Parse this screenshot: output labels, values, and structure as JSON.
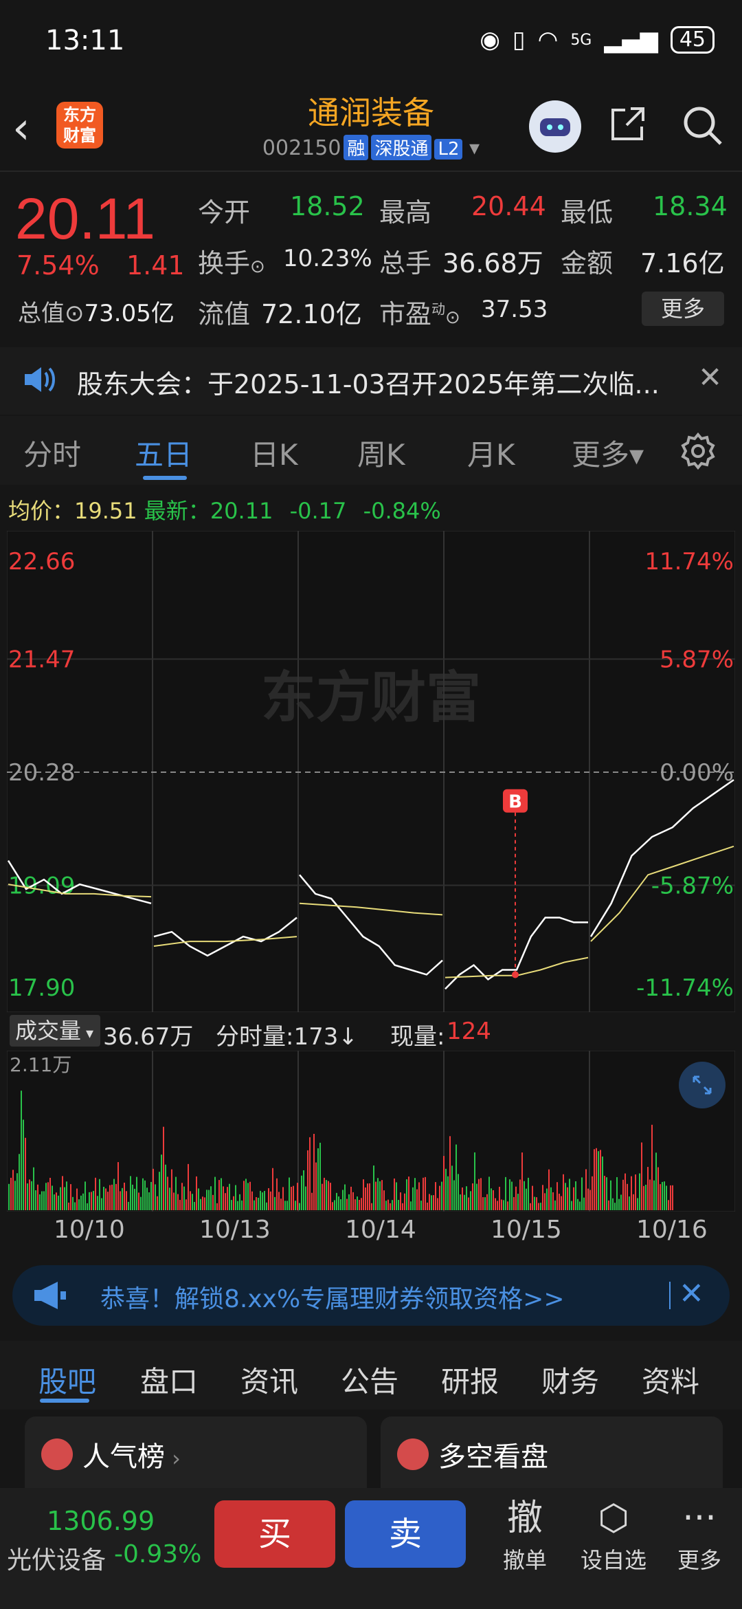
{
  "status_bar": {
    "time": "13:11",
    "network": "5G",
    "battery": "45"
  },
  "header": {
    "logo_line1": "东方",
    "logo_line2": "财富",
    "title": "通润装备",
    "code": "002150",
    "tags": [
      "融",
      "深股通",
      "L2"
    ]
  },
  "quote": {
    "price": "20.11",
    "change_pct": "7.54%",
    "change": "1.41",
    "total_mv_label": "总值",
    "total_mv": "73.05亿",
    "fields": [
      [
        {
          "label": "今开",
          "value": "18.52",
          "color": "green"
        },
        {
          "label": "最高",
          "value": "20.44",
          "color": "red"
        },
        {
          "label": "最低",
          "value": "18.34",
          "color": "green"
        }
      ],
      [
        {
          "label": "换手",
          "value": "10.23%",
          "color": "white"
        },
        {
          "label": "总手",
          "value": "36.68万",
          "color": "white"
        },
        {
          "label": "金额",
          "value": "7.16亿",
          "color": "white"
        }
      ],
      [
        {
          "label": "流值",
          "value": "72.10亿",
          "color": "white"
        },
        {
          "label": "市盈",
          "value": "37.53",
          "color": "white",
          "sup": "动"
        }
      ]
    ],
    "more_label": "更多"
  },
  "notice": {
    "text": "股东大会：于2025-11-03召开2025年第二次临..."
  },
  "tabs": [
    {
      "label": "分时",
      "active": false
    },
    {
      "label": "五日",
      "active": true
    },
    {
      "label": "日K",
      "active": false
    },
    {
      "label": "周K",
      "active": false
    },
    {
      "label": "月K",
      "active": false
    },
    {
      "label": "更多▾",
      "active": false
    }
  ],
  "infoline": {
    "avg_label": "均价：",
    "avg": "19.51",
    "latest_label": "最新：",
    "latest": "20.11",
    "diff": "-0.17",
    "diff_pct": "-0.84%"
  },
  "chart_data": {
    "type": "line",
    "title": "",
    "x_dates": [
      "10/10",
      "10/13",
      "10/14",
      "10/15",
      "10/16"
    ],
    "y_ticks": [
      "22.66",
      "21.47",
      "20.28",
      "19.09",
      "17.90"
    ],
    "y_pct_ticks": [
      "11.74%",
      "5.87%",
      "0.00%",
      "-5.87%",
      "-11.74%"
    ],
    "ylim": [
      17.9,
      22.66
    ],
    "reference_price": 20.28,
    "marker": "B",
    "watermark": "东方财富",
    "series": [
      {
        "name": "",
        "color": "#ffffff",
        "days": [
          [
            19.35,
            19.05,
            19.15,
            19.0,
            19.1,
            19.05,
            19.0,
            18.95,
            18.9
          ],
          [
            18.55,
            18.6,
            18.45,
            18.35,
            18.45,
            18.55,
            18.5,
            18.6,
            18.75
          ],
          [
            19.2,
            19.0,
            18.95,
            18.75,
            18.55,
            18.45,
            18.25,
            18.2,
            18.15,
            18.3
          ],
          [
            18.0,
            18.15,
            18.25,
            18.1,
            18.2,
            18.2,
            18.55,
            18.75,
            18.75,
            18.7,
            18.7
          ],
          [
            18.55,
            18.9,
            19.4,
            19.6,
            19.7,
            19.9,
            20.05,
            20.2
          ]
        ]
      },
      {
        "name": "",
        "color": "#e8dc7a",
        "days": [
          [
            19.1,
            19.05,
            19.0,
            19.0,
            18.98,
            18.97
          ],
          [
            18.45,
            18.5,
            18.5,
            18.52,
            18.55
          ],
          [
            18.9,
            18.88,
            18.86,
            18.83,
            18.8,
            18.78
          ],
          [
            18.12,
            18.13,
            18.14,
            18.14,
            18.2,
            18.28,
            18.33
          ],
          [
            18.5,
            18.8,
            19.2,
            19.3,
            19.4,
            19.5
          ]
        ]
      }
    ]
  },
  "volume": {
    "dropdown_label": "成交量",
    "total": "36.67万",
    "minute_label": "分时量:",
    "minute_value": "173↓",
    "now_label": "现量:",
    "now_value": "124",
    "max_label": "2.11万"
  },
  "promo": {
    "text": "恭喜！解锁8.xx%专属理财券领取资格>>"
  },
  "bottom_tabs": [
    {
      "label": "股吧",
      "active": true
    },
    {
      "label": "盘口",
      "active": false
    },
    {
      "label": "资讯",
      "active": false
    },
    {
      "label": "公告",
      "active": false
    },
    {
      "label": "研报",
      "active": false
    },
    {
      "label": "财务",
      "active": false
    },
    {
      "label": "资料",
      "active": false
    }
  ],
  "cards": [
    {
      "title": "人气榜",
      "icon": "chart-icon"
    },
    {
      "title": "多空看盘",
      "icon": "vs-icon"
    }
  ],
  "bottom_bar": {
    "index_value": "1306.99",
    "index_name": "光伏设备",
    "index_pct": "-0.93%",
    "buy": "买",
    "sell": "卖",
    "cancel_icon": "撤",
    "cancel_label": "撤单",
    "watch_label": "设自选",
    "more_label": "更多"
  },
  "colors": {
    "up": "#ee3b3b",
    "down": "#29c24a",
    "accent": "#4a90e2",
    "title": "#f5a623"
  }
}
